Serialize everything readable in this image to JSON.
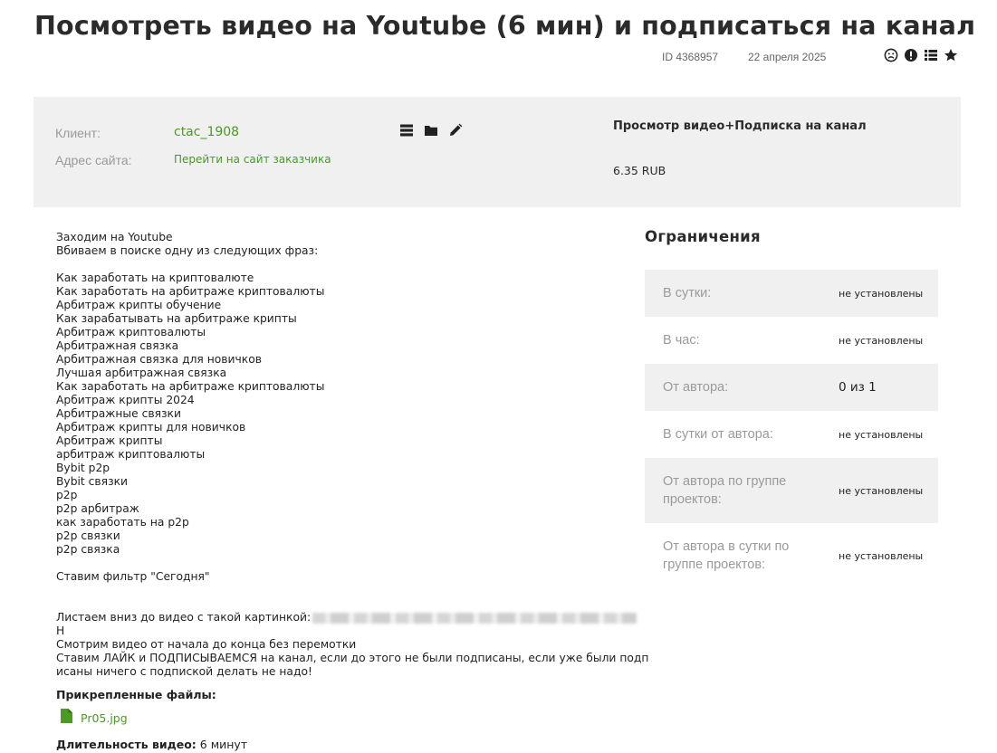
{
  "header": {
    "title": "Посмотреть видео на Youtube (6 мин) и подписаться на канал",
    "id_text": "ID  4368957",
    "date": "22 апреля 2025",
    "icons": [
      "sad-face-icon",
      "exclamation-icon",
      "list-icon",
      "star-icon"
    ]
  },
  "info": {
    "client_label": "Клиент:",
    "client_value": "ctac_1908",
    "site_label": "Адрес сайта:",
    "site_link": "Перейти на сайт заказчика",
    "icons": [
      "menu-icon",
      "folder-icon",
      "pencil-icon"
    ],
    "task_type": "Просмотр видео+Подписка на канал",
    "price": "6.35 RUB"
  },
  "description": {
    "lines": [
      "Заходим на Youtube",
      "Вбиваем в поиске одну из следующих фраз:",
      "",
      "Как заработать на криптовалюте",
      "Как заработать на арбитраже криптовалюты",
      "Арбитраж крипты обучение",
      "Как зарабатывать на арбитраже крипты",
      "Арбитраж криптовалюты",
      "Арбитражная связка",
      "Арбитражная связка для новичков",
      "Лучшая арбитражная связка",
      "Как заработать на арбитраже криптовалюты",
      "Арбитраж крипты 2024",
      "Арбитражные связки",
      "Арбитраж крипты для новичков",
      "Арбитраж крипты",
      "арбитраж криптовалюты",
      "Bybit p2p",
      "Bybit связки",
      "p2p",
      "p2p арбитраж",
      "как заработать на p2p",
      "p2p связки",
      "p2p связка",
      "",
      "Ставим фильтр \"Сегодня\"",
      ""
    ],
    "scroll_line": "Листаем вниз до видео с такой картинкой:",
    "tail_lines": [
      "Н",
      "Смотрим видео от начала до конца без перемотки",
      "Ставим ЛАЙК и ПОДПИСЫВАЕМСЯ на канал, если до этого не были подписаны, если уже были подп",
      "исаны ничего с подпиской делать не надо!"
    ]
  },
  "attachments": {
    "title": "Прикрепленные файлы:",
    "file_name": "Pr05.jpg",
    "file_icon": "file-icon"
  },
  "duration": {
    "label": "Длительность видео:",
    "value": "6 минут"
  },
  "limits": {
    "title": "Ограничения",
    "rows": [
      {
        "label": "В сутки:",
        "value": "не установлены"
      },
      {
        "label": "В час:",
        "value": "не установлены"
      },
      {
        "label": "От автора:",
        "value": "0 из 1"
      },
      {
        "label": "В сутки от автора:",
        "value": "не установлены"
      },
      {
        "label": "От автора по группе проектов:",
        "value": "не установлены"
      },
      {
        "label": "От автора в сутки по группе проектов:",
        "value": "не установлены"
      }
    ]
  },
  "colors": {
    "accent_green": "#4a9a24",
    "band_gray": "#f0f0f0"
  }
}
